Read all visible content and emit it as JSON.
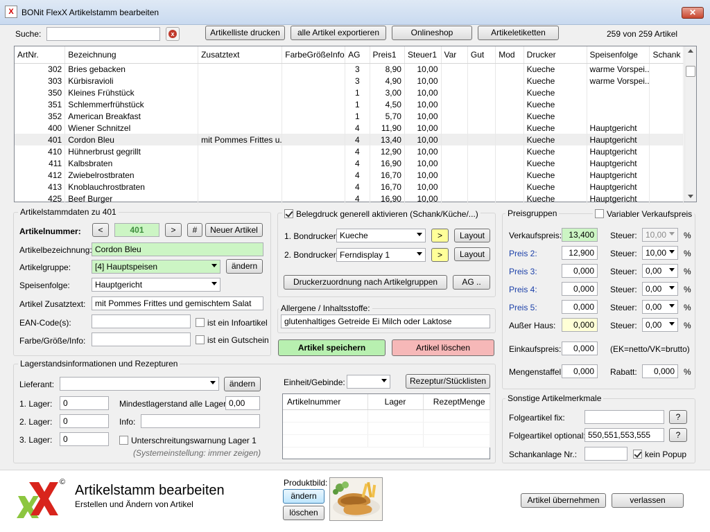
{
  "window": {
    "title": "BONit FlexX Artikelstamm bearbeiten",
    "close_glyph": "✕",
    "app_icon_text": "X"
  },
  "toolbar": {
    "search_label": "Suche:",
    "search_value": "",
    "print_list": "Artikelliste drucken",
    "export_all": "alle Artikel exportieren",
    "onlineshop": "Onlineshop",
    "labels": "Artikeletiketten",
    "count": "259 von 259 Artikel"
  },
  "grid": {
    "columns": [
      "ArtNr.",
      "Bezeichnung",
      "Zusatztext",
      "FarbeGrößeInfo",
      "AG",
      "Preis1",
      "Steuer1",
      "Var",
      "Gut",
      "Mod",
      "Drucker",
      "Speisenfolge",
      "Schank"
    ],
    "rows": [
      [
        "302",
        "Bries gebacken",
        "",
        "",
        "3",
        "8,90",
        "10,00",
        "",
        "",
        "",
        "Kueche",
        "warme Vorspei...",
        ""
      ],
      [
        "303",
        "Kürbisravioli",
        "",
        "",
        "3",
        "4,90",
        "10,00",
        "",
        "",
        "",
        "Kueche",
        "warme Vorspei...",
        ""
      ],
      [
        "350",
        "Kleines Frühstück",
        "",
        "",
        "1",
        "3,00",
        "10,00",
        "",
        "",
        "",
        "Kueche",
        "",
        ""
      ],
      [
        "351",
        "Schlemmerfrühstück",
        "",
        "",
        "1",
        "4,50",
        "10,00",
        "",
        "",
        "",
        "Kueche",
        "",
        ""
      ],
      [
        "352",
        "American Breakfast",
        "",
        "",
        "1",
        "5,70",
        "10,00",
        "",
        "",
        "",
        "Kueche",
        "",
        ""
      ],
      [
        "400",
        "Wiener Schnitzel",
        "",
        "",
        "4",
        "11,90",
        "10,00",
        "",
        "",
        "",
        "Kueche",
        "Hauptgericht",
        ""
      ],
      [
        "401",
        "Cordon Bleu",
        "mit Pommes Frittes u...",
        "",
        "4",
        "13,40",
        "10,00",
        "",
        "",
        "",
        "Kueche",
        "Hauptgericht",
        ""
      ],
      [
        "410",
        "Hühnerbrust gegrillt",
        "",
        "",
        "4",
        "12,90",
        "10,00",
        "",
        "",
        "",
        "Kueche",
        "Hauptgericht",
        ""
      ],
      [
        "411",
        "Kalbsbraten",
        "",
        "",
        "4",
        "16,90",
        "10,00",
        "",
        "",
        "",
        "Kueche",
        "Hauptgericht",
        ""
      ],
      [
        "412",
        "Zwiebelrostbraten",
        "",
        "",
        "4",
        "16,70",
        "10,00",
        "",
        "",
        "",
        "Kueche",
        "Hauptgericht",
        ""
      ],
      [
        "413",
        "Knoblauchrostbraten",
        "",
        "",
        "4",
        "16,70",
        "10,00",
        "",
        "",
        "",
        "Kueche",
        "Hauptgericht",
        ""
      ],
      [
        "425",
        "Beef Burger",
        "",
        "",
        "4",
        "16,90",
        "10,00",
        "",
        "",
        "",
        "Kueche",
        "Hauptgericht",
        ""
      ]
    ],
    "selected_row": 6
  },
  "stamm": {
    "title": "Artikelstammdaten zu 401",
    "artnr_label": "Artikelnummer:",
    "prev": "<",
    "artnr_value": "401",
    "next": ">",
    "hash": "#",
    "new_article": "Neuer Artikel",
    "bez_label": "Artikelbezeichnung:",
    "bez_value": "Cordon Bleu",
    "group_label": "Artikelgruppe:",
    "group_value": "[4] Hauptspeisen",
    "group_change": "ändern",
    "speise_label": "Speisenfolge:",
    "speise_value": "Hauptgericht",
    "zusatz_label": "Artikel Zusatztext:",
    "zusatz_value": "mit Pommes Frittes und gemischtem Salat",
    "ean_label": "EAN-Code(s):",
    "ean_value": "",
    "info_cb": "ist ein Infoartikel",
    "farbe_label": "Farbe/Größe/Info:",
    "farbe_value": "",
    "gutschein_cb": "ist ein Gutschein"
  },
  "beleg": {
    "checkbox": "Belegdruck generell aktivieren (Schank/Küche/...)",
    "bon1_label": "1. Bondrucker:",
    "bon1_value": "Kueche",
    "bon2_label": "2. Bondrucker:",
    "bon2_value": "Ferndisplay 1",
    "arrow": ">",
    "layout": "Layout",
    "zuordnung": "Druckerzuordnung nach Artikelgruppen",
    "ag": "AG ..",
    "allergene_title": "Allergene / Inhaltsstoffe:",
    "allergene_value": "glutenhaltiges Getreide Ei Milch oder Laktose",
    "save": "Artikel speichern",
    "delete": "Artikel löschen"
  },
  "preise": {
    "title": "Preisgruppen",
    "variable_cb": "Variabler Verkaufspreis",
    "vk_label": "Verkaufspreis:",
    "vk_value": "13,400",
    "p2_label": "Preis 2:",
    "p2_value": "12,900",
    "p3_label": "Preis 3:",
    "p3_value": "0,000",
    "p4_label": "Preis 4:",
    "p4_value": "0,000",
    "p5_label": "Preis 5:",
    "p5_value": "0,000",
    "ausser_label": "Außer Haus:",
    "ausser_value": "0,000",
    "steuer_label": "Steuer:",
    "steuer_values": [
      "10,00",
      "10,00",
      "0,00",
      "0,00",
      "0,00",
      "0,00"
    ],
    "percent": "%",
    "ek_label": "Einkaufspreis:",
    "ek_value": "0,000",
    "ek_note": "(EK=netto/VK=brutto)",
    "mengen_label": "Mengenstaffel:",
    "mengen_value": "0,000",
    "rabatt_label": "Rabatt:",
    "rabatt_value": "0,000"
  },
  "lager": {
    "title": "Lagerstandsinformationen und Rezepturen",
    "lieferant_label": "Lieferant:",
    "lieferant_value": "",
    "lieferant_change": "ändern",
    "lager1_label": "1. Lager:",
    "lager1_value": "0",
    "lager2_label": "2. Lager:",
    "lager2_value": "0",
    "lager3_label": "3. Lager:",
    "lager3_value": "0",
    "min_label": "Mindestlagerstand alle Lager:",
    "min_value": "0,00",
    "info_label": "Info:",
    "info_value": "",
    "warn_cb": "Unterschreitungswarnung Lager 1",
    "sys_note": "(Systemeinstellung: immer zeigen)",
    "einheit_label": "Einheit/Gebinde:",
    "einheit_value": "",
    "rezeptur_btn": "Rezeptur/Stücklisten",
    "rez_cols": [
      "Artikelnummer",
      "Lager",
      "RezeptMenge"
    ]
  },
  "sonstige": {
    "title": "Sonstige Artikelmerkmale",
    "folge_fix_label": "Folgeartikel fix:",
    "folge_fix_value": "",
    "folge_opt_label": "Folgeartikel optional:",
    "folge_opt_value": "550,551,553,555",
    "question": "?",
    "schank_label": "Schankanlage Nr.:",
    "schank_value": "",
    "popup_cb": "kein Popup"
  },
  "footer": {
    "logo": "X",
    "logo_mark": "©",
    "heading": "Artikelstamm bearbeiten",
    "subheading": "Erstellen und Ändern von Artikel",
    "produktbild_label": "Produktbild:",
    "change": "ändern",
    "delete": "löschen",
    "apply": "Artikel übernehmen",
    "leave": "verlassen"
  },
  "colors": {
    "green_field": "#ccf5c4",
    "save_button": "#b8f0b0",
    "delete_button": "#f6b8b8",
    "yellow_button": "#ffff99",
    "price_link_blue": "#1a3fa8"
  }
}
